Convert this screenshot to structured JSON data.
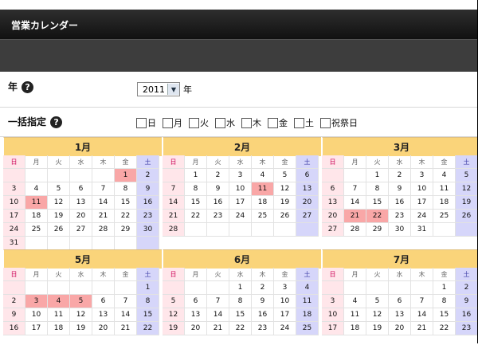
{
  "window": {
    "title": "営業カレンダー"
  },
  "year_row": {
    "label": "年",
    "help": "?",
    "selected_year": "2011",
    "unit": "年"
  },
  "bulk_row": {
    "label": "一括指定",
    "help": "?",
    "options": [
      "日",
      "月",
      "火",
      "水",
      "木",
      "金",
      "土",
      "祝祭日"
    ]
  },
  "weekdays": [
    "日",
    "月",
    "火",
    "水",
    "木",
    "金",
    "土"
  ],
  "months": [
    {
      "label": "1月",
      "rows": [
        [
          "",
          "",
          "",
          "",
          "",
          "1",
          "2"
        ],
        [
          "3",
          "4",
          "5",
          "6",
          "7",
          "8",
          "9"
        ],
        [
          "10",
          "11",
          "12",
          "13",
          "14",
          "15",
          "16"
        ],
        [
          "17",
          "18",
          "19",
          "20",
          "21",
          "22",
          "23"
        ],
        [
          "24",
          "25",
          "26",
          "27",
          "28",
          "29",
          "30"
        ],
        [
          "31",
          "",
          "",
          "",
          "",
          "",
          ""
        ]
      ],
      "holidays": [
        "1",
        "11"
      ]
    },
    {
      "label": "2月",
      "rows": [
        [
          "",
          "1",
          "2",
          "3",
          "4",
          "5",
          "6"
        ],
        [
          "7",
          "8",
          "9",
          "10",
          "11",
          "12",
          "13"
        ],
        [
          "14",
          "15",
          "16",
          "17",
          "18",
          "19",
          "20"
        ],
        [
          "21",
          "22",
          "23",
          "24",
          "25",
          "26",
          "27"
        ],
        [
          "28",
          "",
          "",
          "",
          "",
          "",
          ""
        ]
      ],
      "holidays": [
        "11"
      ]
    },
    {
      "label": "3月",
      "rows": [
        [
          "",
          "",
          "1",
          "2",
          "3",
          "4",
          "5"
        ],
        [
          "6",
          "7",
          "8",
          "9",
          "10",
          "11",
          "12"
        ],
        [
          "13",
          "14",
          "15",
          "16",
          "17",
          "18",
          "19"
        ],
        [
          "20",
          "21",
          "22",
          "23",
          "24",
          "25",
          "26"
        ],
        [
          "27",
          "28",
          "29",
          "30",
          "31",
          "",
          ""
        ]
      ],
      "holidays": [
        "21",
        "22"
      ]
    },
    {
      "label": "5月",
      "rows": [
        [
          "",
          "",
          "",
          "",
          "",
          "",
          "1"
        ],
        [
          "2",
          "3",
          "4",
          "5",
          "6",
          "7",
          "8"
        ],
        [
          "9",
          "10",
          "11",
          "12",
          "13",
          "14",
          "15"
        ],
        [
          "16",
          "17",
          "18",
          "19",
          "20",
          "21",
          "22"
        ]
      ],
      "holidays": [
        "3",
        "4",
        "5"
      ]
    },
    {
      "label": "6月",
      "rows": [
        [
          "",
          "",
          "",
          "1",
          "2",
          "3",
          "4"
        ],
        [
          "5",
          "6",
          "7",
          "8",
          "9",
          "10",
          "11"
        ],
        [
          "12",
          "13",
          "14",
          "15",
          "16",
          "17",
          "18"
        ],
        [
          "19",
          "20",
          "21",
          "22",
          "23",
          "24",
          "25"
        ]
      ],
      "holidays": []
    },
    {
      "label": "7月",
      "rows": [
        [
          "",
          "",
          "",
          "",
          "",
          "1",
          "2"
        ],
        [
          "3",
          "4",
          "5",
          "6",
          "7",
          "8",
          "9"
        ],
        [
          "10",
          "11",
          "12",
          "13",
          "14",
          "15",
          "16"
        ],
        [
          "17",
          "18",
          "19",
          "20",
          "21",
          "22",
          "23"
        ]
      ],
      "holidays": []
    }
  ],
  "colors": {
    "month_header": "#fad47a",
    "sunday": "#ffe6ea",
    "saturday": "#d6d6fa",
    "holiday": "#f9a7a7"
  }
}
